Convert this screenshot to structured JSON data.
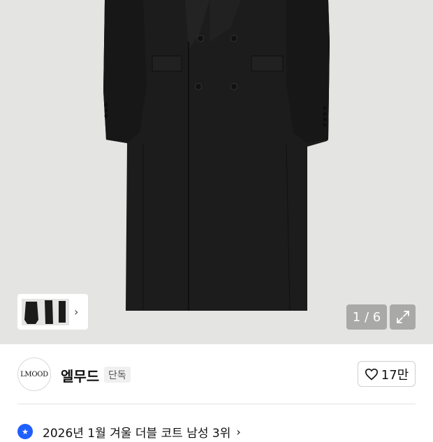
{
  "product_gallery": {
    "page_counter": "1 / 6",
    "thumbnail_count": 3
  },
  "brand": {
    "logo_text": "LMOOD",
    "name": "엘무드",
    "badge": "단독"
  },
  "like": {
    "count": "17만"
  },
  "ranking": {
    "text": "2026년 1월 겨울 더블 코트 남성 3위"
  },
  "icons": [
    "heart-icon",
    "expand-icon",
    "chevron-right-icon",
    "star-badge-icon"
  ],
  "colors": {
    "gallery_bg": "#e4e4e2",
    "coat": "#1a1b1a",
    "rank_badge": "#1f5eff"
  }
}
